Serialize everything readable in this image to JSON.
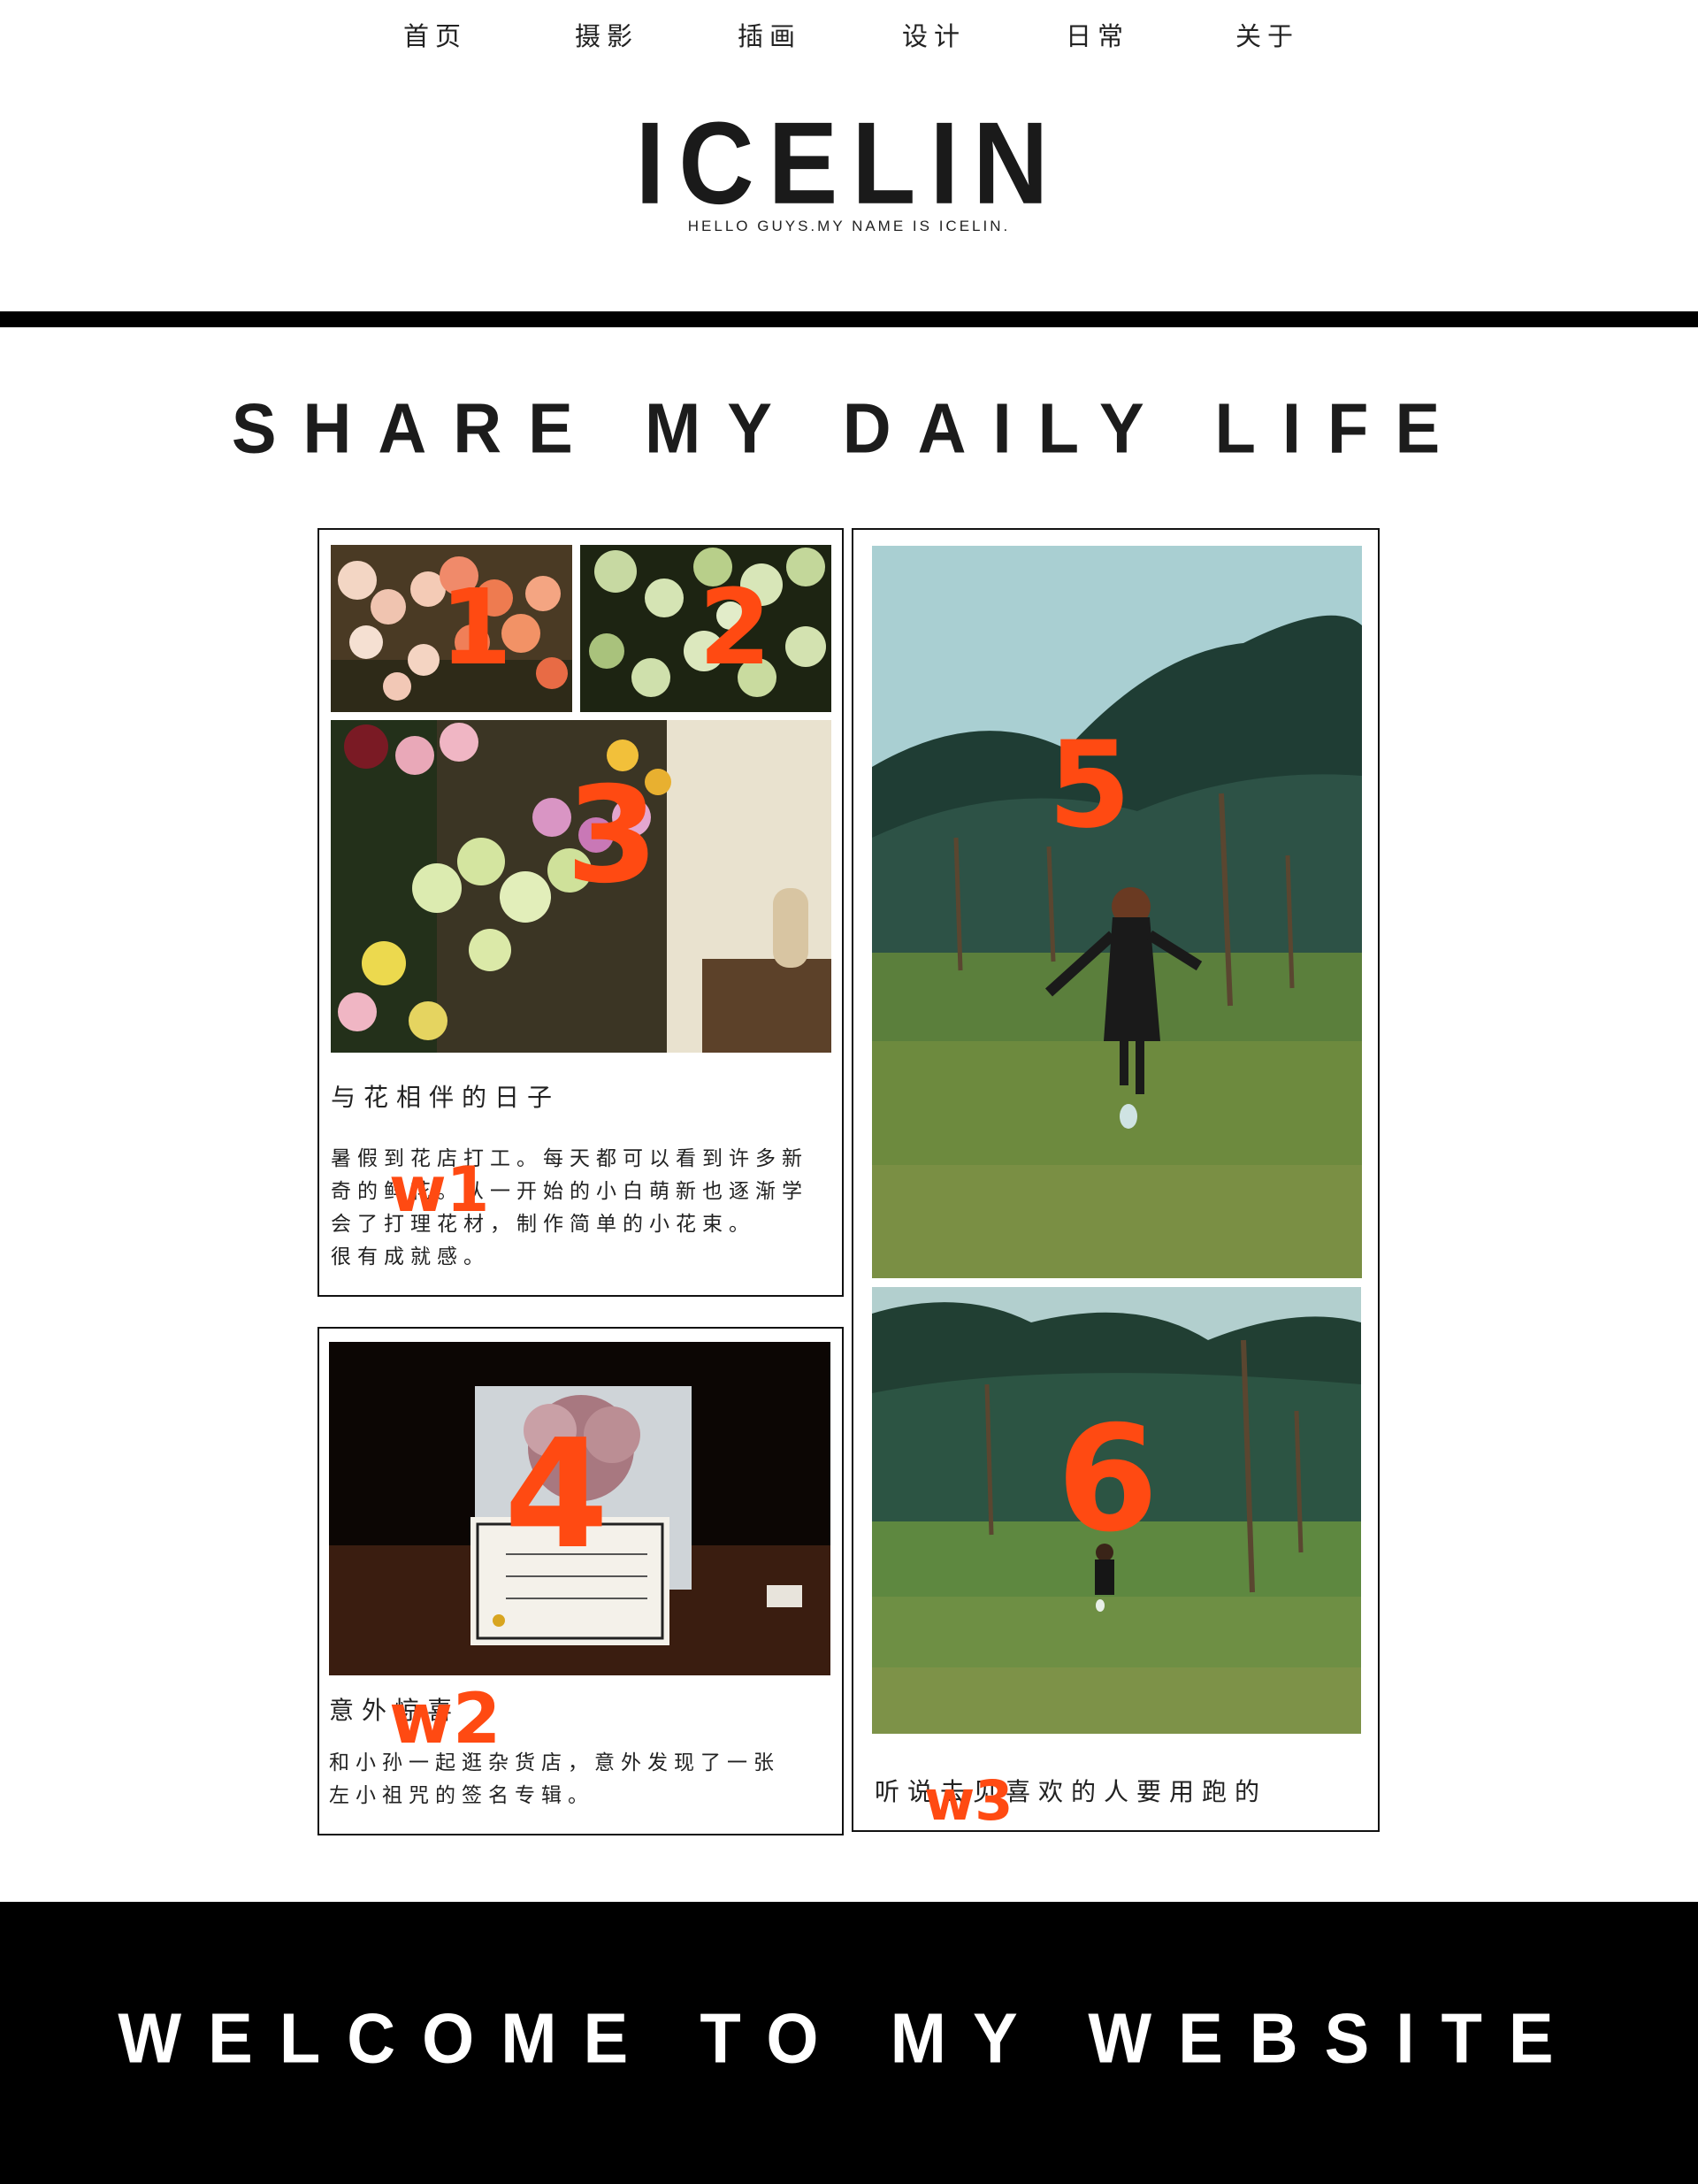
{
  "nav": {
    "items": [
      {
        "label": "首页"
      },
      {
        "label": "摄影"
      },
      {
        "label": "插画"
      },
      {
        "label": "设计"
      },
      {
        "label": "日常"
      },
      {
        "label": "关于"
      }
    ]
  },
  "brand": {
    "title": "ICELIN",
    "subtitle": "HELLO GUYS.MY NAME IS ICELIN."
  },
  "section": {
    "title": "SHARE MY DAILY LIFE"
  },
  "cards": {
    "flowers": {
      "title": "与花相伴的日子",
      "text_lines": [
        "暑假到花店打工。每天都可以看到许多新",
        "奇的鲜花。从一开始的小白萌新也逐渐学",
        "会了打理花材，制作简单的小花束。",
        "很有成就感。"
      ]
    },
    "surprise": {
      "title": "意外惊喜",
      "text_lines": [
        "和小孙一起逛杂货店，意外发现了一张",
        "左小祖咒的签名专辑。"
      ]
    },
    "running": {
      "title": "听说去见喜欢的人要用跑的"
    }
  },
  "annotations": {
    "photo1": "1",
    "photo2": "2",
    "photo3": "3",
    "photo4": "4",
    "photo5": "5",
    "photo6": "6",
    "w1": "w1",
    "w2": "w2",
    "w3": "w3"
  },
  "footer": {
    "text": "WELCOME TO MY WEBSITE"
  },
  "colors": {
    "annotation": "#ff4a12",
    "rule": "#000000",
    "footer_bg": "#000000",
    "footer_text": "#ffffff"
  }
}
